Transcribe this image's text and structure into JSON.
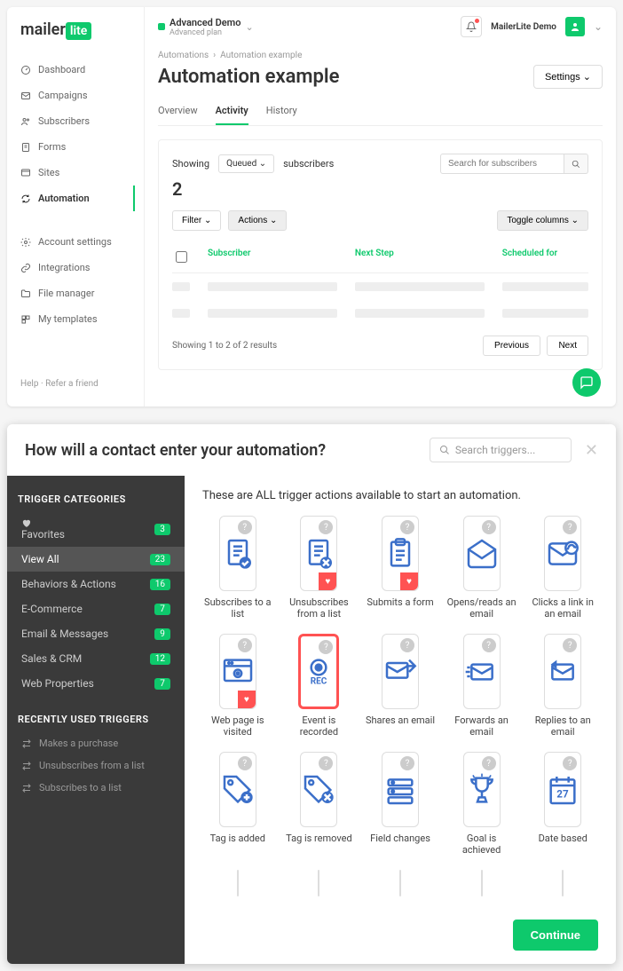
{
  "brand": {
    "name": "mailer",
    "suffix": "lite"
  },
  "account": {
    "name": "Advanced Demo",
    "plan": "Advanced plan",
    "user": "MailerLite Demo"
  },
  "sidebar": {
    "items": [
      {
        "label": "Dashboard",
        "icon": "gauge"
      },
      {
        "label": "Campaigns",
        "icon": "mail"
      },
      {
        "label": "Subscribers",
        "icon": "users"
      },
      {
        "label": "Forms",
        "icon": "form"
      },
      {
        "label": "Sites",
        "icon": "site"
      },
      {
        "label": "Automation",
        "icon": "automation",
        "active": true
      }
    ],
    "secondary": [
      {
        "label": "Account settings",
        "icon": "gear"
      },
      {
        "label": "Integrations",
        "icon": "link"
      },
      {
        "label": "File manager",
        "icon": "folder"
      },
      {
        "label": "My templates",
        "icon": "templates"
      }
    ],
    "footer": {
      "help": "Help",
      "refer": "Refer a friend"
    }
  },
  "breadcrumb": {
    "parent": "Automations",
    "current": "Automation example"
  },
  "page": {
    "title": "Automation example",
    "settings_btn": "Settings"
  },
  "tabs": [
    {
      "label": "Overview"
    },
    {
      "label": "Activity",
      "active": true
    },
    {
      "label": "History"
    }
  ],
  "activity": {
    "showing_prefix": "Showing",
    "queued_label": "Queued",
    "showing_suffix": "subscribers",
    "count": "2",
    "search_placeholder": "Search for subscribers",
    "filter_btn": "Filter",
    "actions_btn": "Actions",
    "toggle_cols": "Toggle columns",
    "columns": {
      "c1": "Subscriber",
      "c2": "Next Step",
      "c3": "Scheduled for"
    },
    "results_text": "Showing 1 to 2 of 2 results",
    "prev": "Previous",
    "next": "Next"
  },
  "modal": {
    "title": "How will a contact enter your automation?",
    "search_placeholder": "Search triggers...",
    "categories_heading": "TRIGGER CATEGORIES",
    "categories": [
      {
        "label": "Favorites",
        "count": 3,
        "icon": "heart"
      },
      {
        "label": "View All",
        "count": 23,
        "active": true
      },
      {
        "label": "Behaviors & Actions",
        "count": 16
      },
      {
        "label": "E-Commerce",
        "count": 7
      },
      {
        "label": "Email & Messages",
        "count": 9
      },
      {
        "label": "Sales & CRM",
        "count": 12
      },
      {
        "label": "Web Properties",
        "count": 7
      }
    ],
    "recent_heading": "RECENTLY USED TRIGGERS",
    "recent": [
      {
        "label": "Makes a purchase"
      },
      {
        "label": "Unsubscribes from a list"
      },
      {
        "label": "Subscribes to a list"
      }
    ],
    "intro": "These are ALL trigger actions available to start an automation.",
    "triggers": [
      {
        "label": "Subscribes to a list",
        "icon": "doc-check"
      },
      {
        "label": "Unsubscribes from a list",
        "icon": "doc-x",
        "fav": true
      },
      {
        "label": "Submits a form",
        "icon": "clipboard",
        "fav": true
      },
      {
        "label": "Opens/reads an email",
        "icon": "mail-open"
      },
      {
        "label": "Clicks a link in an email",
        "icon": "mail-link"
      },
      {
        "label": "Web page is visited",
        "icon": "browser",
        "fav": true
      },
      {
        "label": "Event is recorded",
        "icon": "rec",
        "highlighted": true
      },
      {
        "label": "Shares an email",
        "icon": "mail-share"
      },
      {
        "label": "Forwards an email",
        "icon": "mail-fwd"
      },
      {
        "label": "Replies to an email",
        "icon": "mail-reply"
      },
      {
        "label": "Tag is added",
        "icon": "tag-plus"
      },
      {
        "label": "Tag is removed",
        "icon": "tag-x"
      },
      {
        "label": "Field changes",
        "icon": "fields"
      },
      {
        "label": "Goal is achieved",
        "icon": "trophy"
      },
      {
        "label": "Date based",
        "icon": "calendar"
      }
    ],
    "continue": "Continue"
  }
}
